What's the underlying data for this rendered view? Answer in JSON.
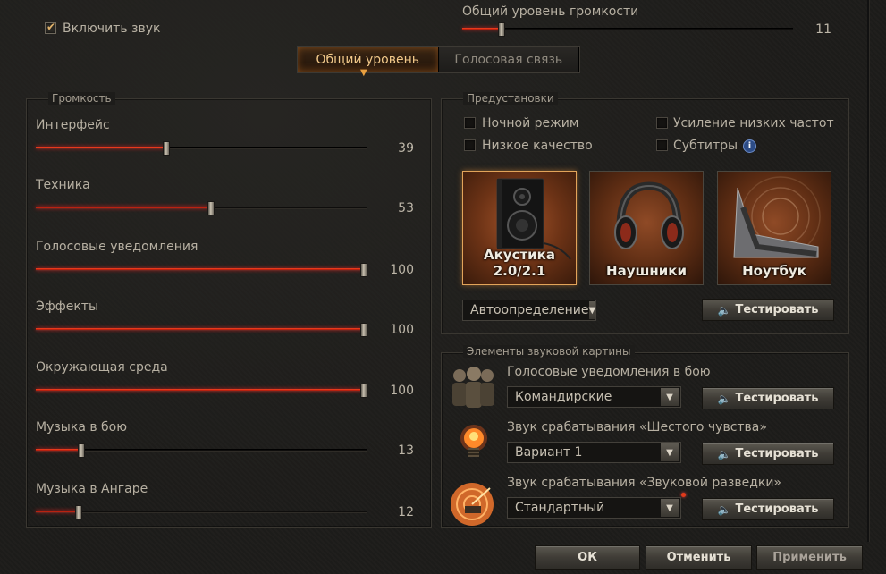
{
  "top": {
    "enable_sound_label": "Включить звук",
    "master_label": "Общий уровень громкости",
    "master_value": "11",
    "master_level": 0.11
  },
  "tabs": [
    {
      "label": "Общий уровень",
      "active": true
    },
    {
      "label": "Голосовая связь",
      "active": false
    }
  ],
  "volume": {
    "legend": "Громкость",
    "sliders": [
      {
        "label": "Интерфейс",
        "value": "39",
        "level": 0.39
      },
      {
        "label": "Техника",
        "value": "53",
        "level": 0.53
      },
      {
        "label": "Голосовые уведомления",
        "value": "100",
        "level": 1.0
      },
      {
        "label": "Эффекты",
        "value": "100",
        "level": 1.0
      },
      {
        "label": "Окружающая среда",
        "value": "100",
        "level": 1.0
      },
      {
        "label": "Музыка в бою",
        "value": "13",
        "level": 0.13
      },
      {
        "label": "Музыка в Ангаре",
        "value": "12",
        "level": 0.12
      }
    ]
  },
  "presets": {
    "legend": "Предустановки",
    "options": [
      {
        "label": "Ночной режим",
        "checked": false
      },
      {
        "label": "Усиление низких частот",
        "checked": false
      },
      {
        "label": "Низкое качество",
        "checked": false
      },
      {
        "label": "Субтитры",
        "checked": false
      }
    ],
    "info_icon": "i",
    "cards": [
      {
        "label": "Акустика 2.0/2.1",
        "icon": "speaker-icon",
        "active": true
      },
      {
        "label": "Наушники",
        "icon": "headphones-icon",
        "active": false
      },
      {
        "label": "Ноутбук",
        "icon": "laptop-icon",
        "active": false
      }
    ],
    "device_select": "Автоопределение",
    "test_label": "Тестировать"
  },
  "elements": {
    "legend": "Элементы звуковой картины",
    "rows": [
      {
        "label": "Голосовые уведомления в бою",
        "select": "Командирские",
        "test": "Тестировать",
        "icon": "crew-icon"
      },
      {
        "label": "Звук срабатывания «Шестого чувства»",
        "select": "Вариант 1",
        "test": "Тестировать",
        "icon": "lightbulb-icon"
      },
      {
        "label": "Звук срабатывания «Звуковой разведки»",
        "select": "Стандартный",
        "test": "Тестировать",
        "icon": "radar-icon"
      }
    ]
  },
  "footer": {
    "ok": "ОК",
    "cancel": "Отменить",
    "apply": "Применить"
  },
  "colors": {
    "accent": "#f2c98a",
    "slider_fill": "#e0301a",
    "background": "#1d1c1a"
  }
}
